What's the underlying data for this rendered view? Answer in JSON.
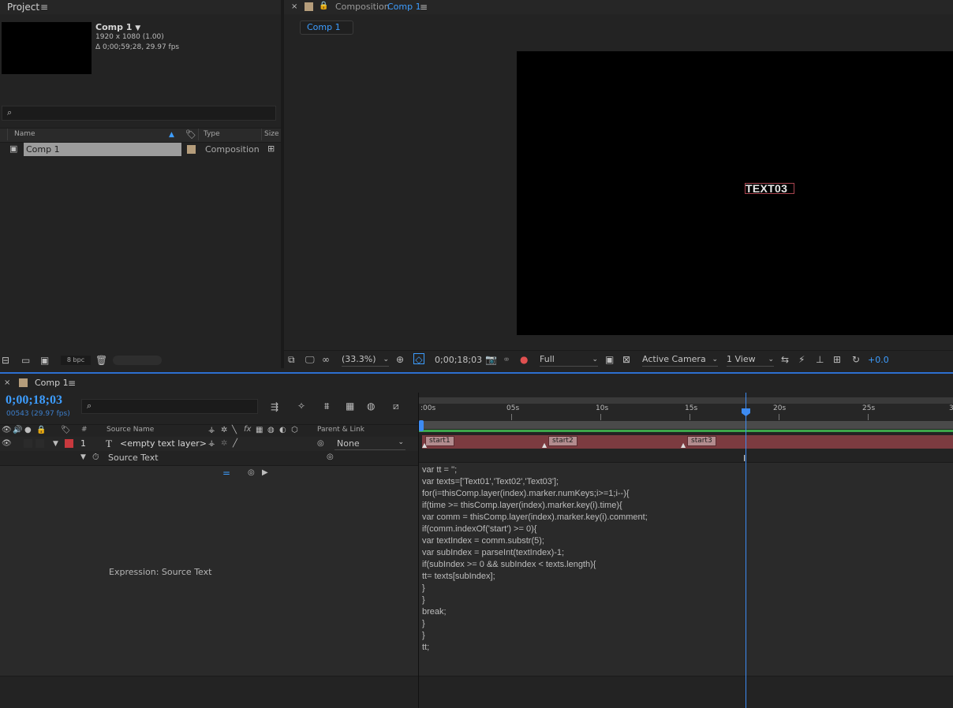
{
  "project": {
    "panel_title": "Project",
    "comp_name": "Comp 1",
    "comp_dims": "1920 x 1080 (1.00)",
    "comp_duration": "Δ 0;00;59;28, 29.97 fps",
    "columns": {
      "name": "Name",
      "type": "Type",
      "size": "Size"
    },
    "items": [
      {
        "name": "Comp 1",
        "type": "Composition",
        "label_color": "#b59d7b"
      }
    ],
    "bpc": "8 bpc"
  },
  "viewer": {
    "panel_label": "Composition",
    "comp_name": "Comp 1",
    "tab_chip": "Comp 1",
    "canvas_text": "TEXT03",
    "toolbar": {
      "zoom": "(33.3%)",
      "timecode": "0;00;18;03",
      "resolution": "Full",
      "camera": "Active Camera",
      "views": "1 View",
      "exposure": "+0.0"
    }
  },
  "timeline": {
    "tab_label": "Comp 1",
    "current_time": "0;00;18;03",
    "current_frame": "00543 (29.97 fps)",
    "columns": {
      "num": "#",
      "source_name": "Source Name",
      "parent": "Parent & Link"
    },
    "layer": {
      "index": "1",
      "name": "<empty text layer>",
      "parent": "None",
      "label_color": "#c8393e"
    },
    "property": "Source Text",
    "expression_label": "Expression: Source Text",
    "ruler_ticks": [
      ":00s",
      "05s",
      "10s",
      "15s",
      "20s",
      "25s",
      "3"
    ],
    "markers": [
      "start1",
      "start2",
      "start3"
    ],
    "expression_code": [
      "var tt = '';",
      "var texts=['Text01','Text02','Text03'];",
      "for(i=thisComp.layer(index).marker.numKeys;i>=1;i--){",
      "if(time >= thisComp.layer(index).marker.key(i).time){",
      "var comm = thisComp.layer(index).marker.key(i).comment;",
      "if(comm.indexOf('start') >= 0){",
      "var textIndex = comm.substr(5);",
      "var subIndex = parseInt(textIndex)-1;",
      "if(subIndex >= 0 && subIndex < texts.length){",
      "tt= texts[subIndex];",
      "}",
      "}",
      "break;",
      "}",
      "}",
      "tt;"
    ]
  },
  "colors": {
    "accent": "#3d9dff",
    "work_area": "#3da64a",
    "layer_bar": "#7c3b40"
  }
}
